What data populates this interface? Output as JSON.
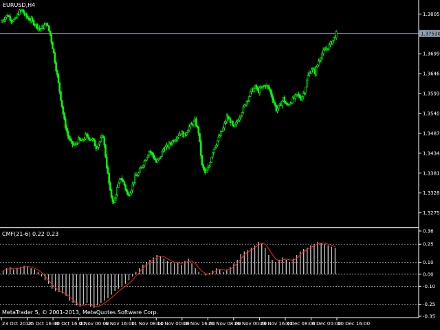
{
  "window": {
    "symbol_label": "EURUSD,H4",
    "indicator_label": "CMF(21-6) 0.22 0.23",
    "copyright": "MetaTrader 5, © 2001-2013, MetaQuotes Software Corp."
  },
  "colors": {
    "background": "#000000",
    "candle_bull": "#00ff00",
    "candle_bear": "#00ff00",
    "price_line": "#8fa3b8",
    "histogram": "#c0c0c0",
    "signal_line": "#ff2020",
    "axis_text": "#ffffff",
    "separator": "#b0b0b0",
    "grid_dotted": "#c0c0c0",
    "price_box_bg": "#8fa3b8"
  },
  "price_axis": {
    "ticks": [
      "1.38050",
      "1.36990",
      "1.36460",
      "1.35930",
      "1.35400",
      "1.34870",
      "1.34340",
      "1.33810",
      "1.33280",
      "1.32750"
    ],
    "current_price": "1.37530"
  },
  "indicator_axis": {
    "ticks": [
      "0.36",
      "0.25",
      "0.10",
      "0.00",
      "-0.10",
      "-0.25",
      "-0.35"
    ]
  },
  "time_axis": {
    "ticks": [
      "23 Oct 2013",
      "25 Oct 16:00",
      "30 Oct 16:00",
      "4 Nov 00:00",
      "6 Nov 16:00",
      "11 Nov 08:00",
      "14 Nov 00:00",
      "18 Nov 16:00",
      "21 Nov 08:00",
      "26 Nov 00:00",
      "28 Nov 16:00",
      "3 Dec 08:00",
      "6 Dec 00:00",
      "10 Dec 16:00"
    ]
  },
  "chart_data": {
    "type": "candlestick",
    "symbol": "EURUSD",
    "timeframe": "H4",
    "price_range": [
      1.3245,
      1.3835
    ],
    "current_price": 1.3753,
    "close_path": [
      1.3782,
      1.3795,
      1.3802,
      1.379,
      1.3788,
      1.3808,
      1.3815,
      1.38,
      1.3792,
      1.3785,
      1.3775,
      1.3765,
      1.377,
      1.378,
      1.375,
      1.37,
      1.364,
      1.358,
      1.352,
      1.348,
      1.346,
      1.3455,
      1.347,
      1.3465,
      1.348,
      1.3475,
      1.347,
      1.345,
      1.3465,
      1.348,
      1.34,
      1.333,
      1.33,
      1.334,
      1.337,
      1.335,
      1.332,
      1.334,
      1.337,
      1.338,
      1.34,
      1.342,
      1.344,
      1.343,
      1.341,
      1.342,
      1.3445,
      1.345,
      1.346,
      1.347,
      1.348,
      1.349,
      1.348,
      1.35,
      1.351,
      1.352,
      1.349,
      1.34,
      1.338,
      1.34,
      1.344,
      1.346,
      1.348,
      1.35,
      1.353,
      1.352,
      1.35,
      1.352,
      1.354,
      1.356,
      1.358,
      1.36,
      1.361,
      1.36,
      1.361,
      1.3615,
      1.3605,
      1.358,
      1.355,
      1.356,
      1.358,
      1.356,
      1.357,
      1.358,
      1.359,
      1.358,
      1.36,
      1.364,
      1.366,
      1.365,
      1.368,
      1.37,
      1.371,
      1.372,
      1.3735,
      1.3753
    ],
    "cmf_values": [
      0.03,
      0.05,
      0.06,
      0.04,
      0.05,
      0.06,
      0.07,
      0.06,
      0.05,
      0.04,
      0.02,
      -0.02,
      -0.05,
      -0.08,
      -0.12,
      -0.14,
      -0.15,
      -0.16,
      -0.18,
      -0.22,
      -0.24,
      -0.26,
      -0.27,
      -0.25,
      -0.24,
      -0.27,
      -0.28,
      -0.26,
      -0.24,
      -0.22,
      -0.2,
      -0.17,
      -0.14,
      -0.12,
      -0.1,
      -0.08,
      -0.05,
      -0.02,
      0.02,
      0.05,
      0.08,
      0.1,
      0.12,
      0.14,
      0.16,
      0.15,
      0.13,
      0.11,
      0.1,
      0.09,
      0.1,
      0.08,
      0.11,
      0.13,
      0.09,
      0.05,
      0.02,
      0.0,
      -0.01,
      0.01,
      0.03,
      0.05,
      0.04,
      0.02,
      0.04,
      0.06,
      0.09,
      0.12,
      0.17,
      0.19,
      0.2,
      0.22,
      0.24,
      0.27,
      0.26,
      0.22,
      0.16,
      0.12,
      0.1,
      0.12,
      0.14,
      0.12,
      0.1,
      0.13,
      0.16,
      0.19,
      0.21,
      0.22,
      0.24,
      0.25,
      0.27,
      0.26,
      0.25,
      0.24,
      0.23,
      0.22
    ],
    "cmf_range": [
      -0.35,
      0.36
    ],
    "levels": [
      0.25,
      0.1,
      0.0,
      -0.1,
      -0.25
    ]
  }
}
